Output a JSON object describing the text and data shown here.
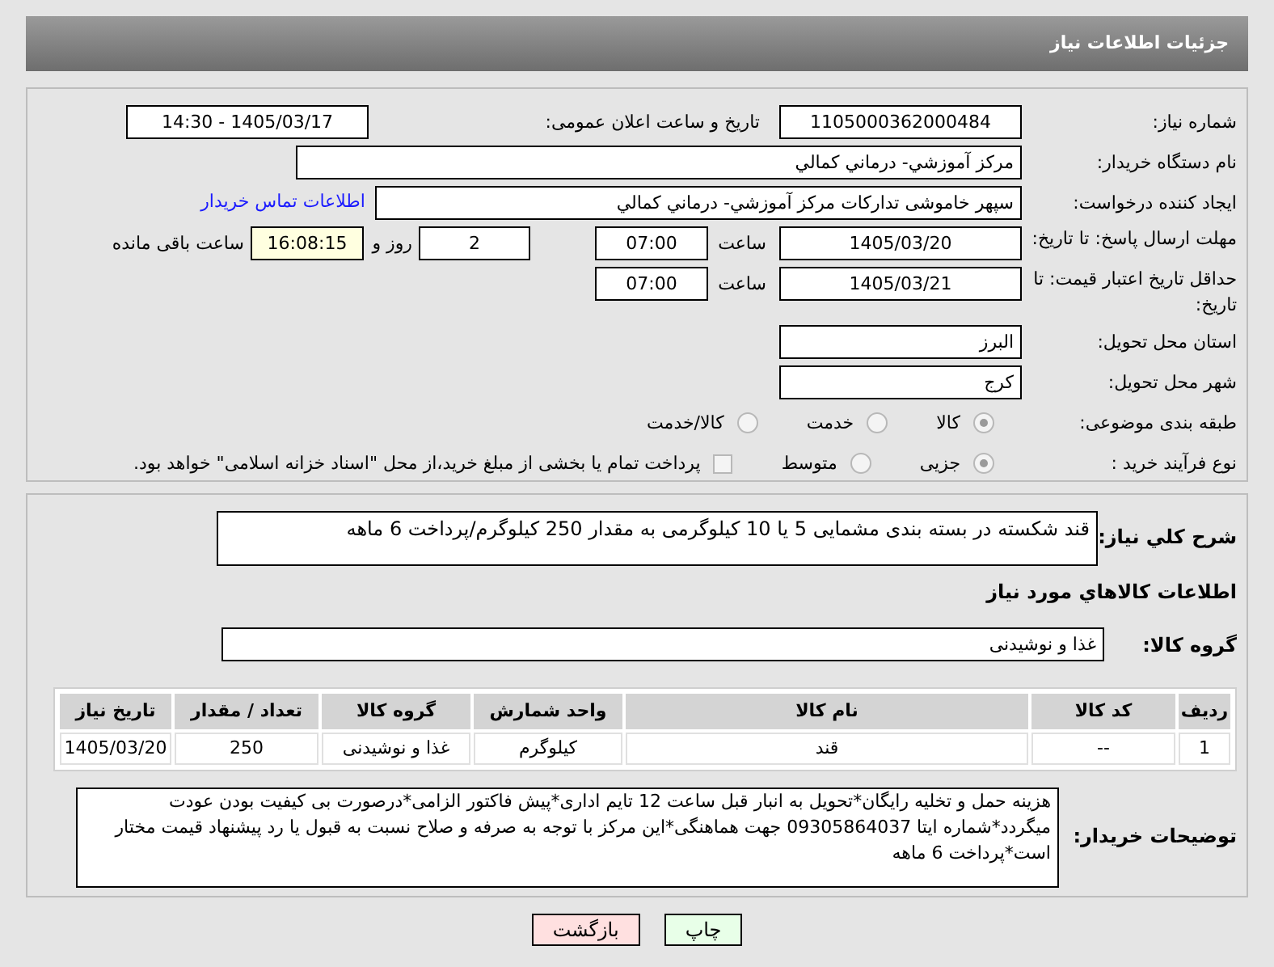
{
  "header": {
    "title": "جزئیات اطلاعات نیاز"
  },
  "info": {
    "need_number": {
      "label": "شماره نیاز:",
      "value": "1105000362000484"
    },
    "announce": {
      "label": "تاریخ و ساعت اعلان عمومی:",
      "value": "1405/03/17 - 14:30"
    },
    "buyer_org": {
      "label": "نام دستگاه خریدار:",
      "value": "مرکز آموزشي- درماني کمالي"
    },
    "creator": {
      "label": "ایجاد کننده درخواست:",
      "value": "سپهر خاموشی تدارکات مرکز آموزشي- درماني کمالي",
      "link": "اطلاعات تماس خریدار"
    },
    "deadline": {
      "label": "مهلت ارسال پاسخ: تا تاریخ:",
      "date": "1405/03/20",
      "time_label": "ساعت",
      "time": "07:00",
      "days": "2",
      "days_label": "روز و",
      "remaining": "16:08:15",
      "remaining_label": "ساعت باقی مانده"
    },
    "validity": {
      "label": "حداقل تاریخ اعتبار قیمت: تا تاریخ:",
      "date": "1405/03/21",
      "time_label": "ساعت",
      "time": "07:00"
    },
    "province": {
      "label": "استان محل تحویل:",
      "value": "البرز"
    },
    "city": {
      "label": "شهر محل تحویل:",
      "value": "کرج"
    },
    "category": {
      "label": "طبقه بندی موضوعی:",
      "options": [
        {
          "label": "کالا",
          "selected": true
        },
        {
          "label": "خدمت",
          "selected": false
        },
        {
          "label": "کالا/خدمت",
          "selected": false
        }
      ]
    },
    "process": {
      "label": "نوع فرآیند خرید :",
      "options": [
        {
          "label": "جزیی",
          "selected": true
        },
        {
          "label": "متوسط",
          "selected": false
        }
      ],
      "treasury": {
        "label": "پرداخت تمام یا بخشی از مبلغ خرید،از محل \"اسناد خزانه اسلامی\" خواهد بود.",
        "checked": false
      }
    }
  },
  "details": {
    "description": {
      "label": "شرح کلي نياز:",
      "value": "قند شکسته در بسته بندی مشمایی 5 یا 10 کیلوگرمی به مقدار 250 کیلوگرم/پرداخت 6 ماهه"
    },
    "items_title": "اطلاعات کالاهاي مورد نياز",
    "group": {
      "label": "گروه کالا:",
      "value": "غذا و نوشیدنی"
    },
    "table": {
      "columns": [
        "ردیف",
        "کد کالا",
        "نام کالا",
        "واحد شمارش",
        "گروه کالا",
        "تعداد / مقدار",
        "تاریخ نیاز"
      ],
      "rows": [
        [
          "1",
          "--",
          "قند",
          "کیلوگرم",
          "غذا و نوشیدنی",
          "250",
          "1405/03/20"
        ]
      ]
    },
    "notes": {
      "label": "توضیحات خریدار:",
      "value": "هزینه حمل و تخلیه رایگان*تحویل به انبار قبل ساعت 12 تایم اداری*پیش فاکتور الزامی*درصورت بی کیفیت بودن عودت میگردد*شماره ایتا 09305864037 جهت هماهنگی*این مرکز با توجه به صرفه و صلاح نسبت به قبول یا رد پیشنهاد قیمت مختار است*پرداخت 6 ماهه"
    }
  },
  "buttons": [
    {
      "kind": "print",
      "label": "چاپ"
    },
    {
      "kind": "back",
      "label": "بازگشت"
    }
  ]
}
